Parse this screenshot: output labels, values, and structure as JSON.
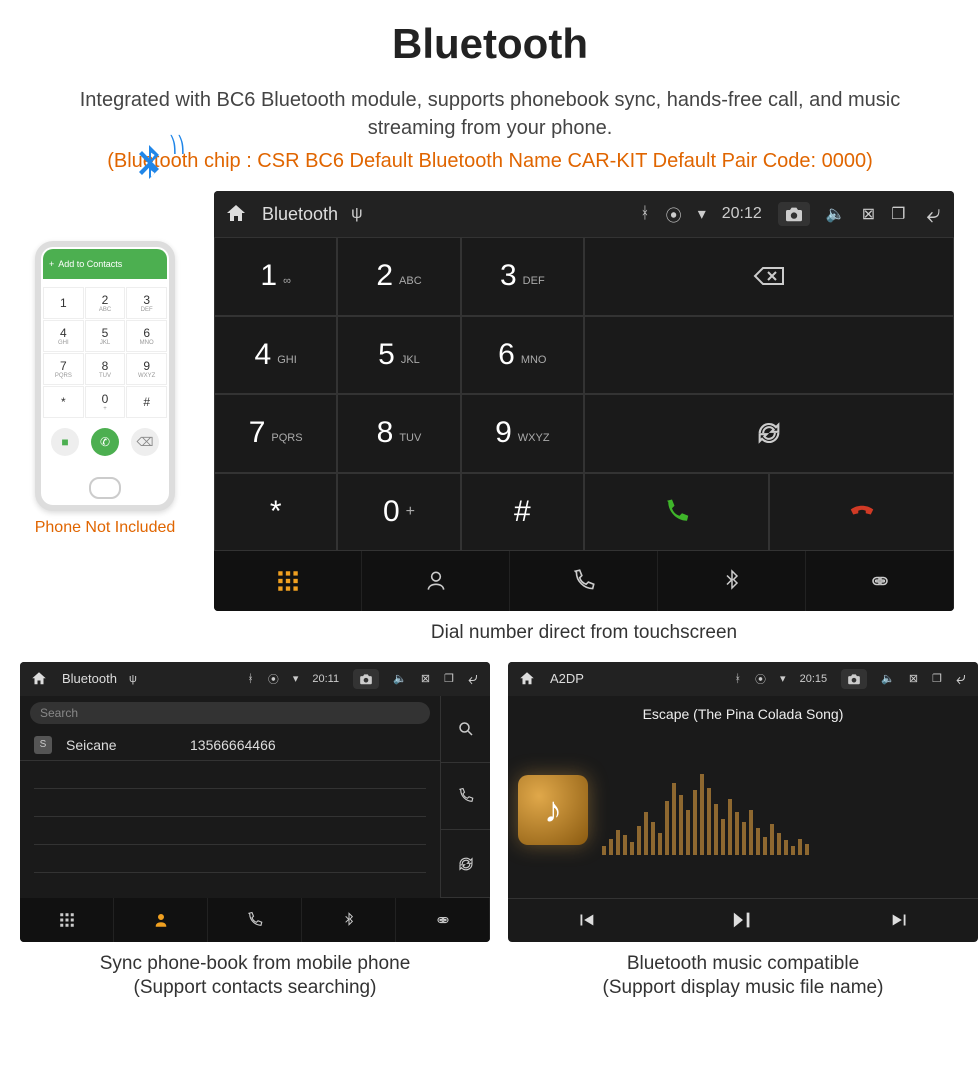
{
  "page": {
    "title": "Bluetooth",
    "description": "Integrated with BC6 Bluetooth module, supports phonebook sync, hands-free call, and music streaming from your phone.",
    "specs": "(Bluetooth chip : CSR BC6    Default Bluetooth Name CAR-KIT    Default Pair Code: 0000)"
  },
  "phone_mock": {
    "header": "Add to Contacts",
    "keys": [
      {
        "n": "1",
        "s": ""
      },
      {
        "n": "2",
        "s": "ABC"
      },
      {
        "n": "3",
        "s": "DEF"
      },
      {
        "n": "4",
        "s": "GHI"
      },
      {
        "n": "5",
        "s": "JKL"
      },
      {
        "n": "6",
        "s": "MNO"
      },
      {
        "n": "7",
        "s": "PQRS"
      },
      {
        "n": "8",
        "s": "TUV"
      },
      {
        "n": "9",
        "s": "WXYZ"
      },
      {
        "n": "*",
        "s": ""
      },
      {
        "n": "0",
        "s": "+"
      },
      {
        "n": "#",
        "s": ""
      }
    ],
    "caption": "Phone Not Included"
  },
  "dialer": {
    "status": {
      "title": "Bluetooth",
      "time": "20:12"
    },
    "keys": [
      {
        "n": "1",
        "s": "∞"
      },
      {
        "n": "2",
        "s": "ABC"
      },
      {
        "n": "3",
        "s": "DEF"
      },
      {
        "n": "4",
        "s": "GHI"
      },
      {
        "n": "5",
        "s": "JKL"
      },
      {
        "n": "6",
        "s": "MNO"
      },
      {
        "n": "7",
        "s": "PQRS"
      },
      {
        "n": "8",
        "s": "TUV"
      },
      {
        "n": "9",
        "s": "WXYZ"
      },
      {
        "n": "*",
        "s": ""
      },
      {
        "n": "0",
        "s": "+"
      },
      {
        "n": "#",
        "s": ""
      }
    ],
    "caption": "Dial number direct from touchscreen"
  },
  "phonebook": {
    "status": {
      "title": "Bluetooth",
      "time": "20:11"
    },
    "search_placeholder": "Search",
    "contacts": [
      {
        "badge": "S",
        "name": "Seicane",
        "number": "13566664466"
      }
    ],
    "caption1": "Sync phone-book from mobile phone",
    "caption2": "(Support contacts searching)"
  },
  "music": {
    "status": {
      "title": "A2DP",
      "time": "20:15"
    },
    "song": "Escape (The Pina Colada Song)",
    "eq_bars": [
      10,
      18,
      28,
      22,
      14,
      32,
      48,
      36,
      24,
      60,
      80,
      66,
      50,
      72,
      90,
      74,
      56,
      40,
      62,
      48,
      36,
      50,
      30,
      20,
      34,
      24,
      16,
      10,
      18,
      12
    ],
    "caption1": "Bluetooth music compatible",
    "caption2": "(Support display music file name)"
  },
  "colors": {
    "accent_orange": "#e06500",
    "call_green": "#3fb52a",
    "call_red": "#d13a25",
    "tab_active": "#f0a020"
  }
}
